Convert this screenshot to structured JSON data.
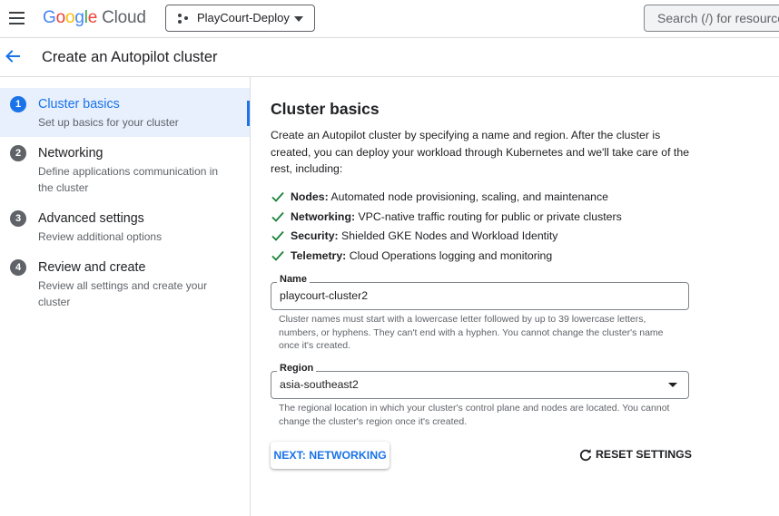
{
  "topbar": {
    "logo_letters": [
      "G",
      "o",
      "o",
      "g",
      "l",
      "e"
    ],
    "logo_product": "Cloud",
    "project_name": "PlayCourt-Deploy",
    "search_placeholder": "Search (/) for resources"
  },
  "page": {
    "title": "Create an Autopilot cluster"
  },
  "steps": [
    {
      "number": "1",
      "title": "Cluster basics",
      "description": "Set up basics for your cluster",
      "active": true
    },
    {
      "number": "2",
      "title": "Networking",
      "description": "Define applications communication in the cluster",
      "active": false
    },
    {
      "number": "3",
      "title": "Advanced settings",
      "description": "Review additional options",
      "active": false
    },
    {
      "number": "4",
      "title": "Review and create",
      "description": "Review all settings and create your cluster",
      "active": false
    }
  ],
  "main": {
    "section_title": "Cluster basics",
    "intro": "Create an Autopilot cluster by specifying a name and region. After the cluster is created, you can deploy your workload through Kubernetes and we'll take care of the rest, including:",
    "features": [
      {
        "label": "Nodes:",
        "text": " Automated node provisioning, scaling, and maintenance"
      },
      {
        "label": "Networking:",
        "text": " VPC-native traffic routing for public or private clusters"
      },
      {
        "label": "Security:",
        "text": " Shielded GKE Nodes and Workload Identity"
      },
      {
        "label": "Telemetry:",
        "text": " Cloud Operations logging and monitoring"
      }
    ],
    "name_field": {
      "label": "Name",
      "value": "playcourt-cluster2",
      "hint": "Cluster names must start with a lowercase letter followed by up to 39 lowercase letters, numbers, or hyphens. They can't end with a hyphen. You cannot change the cluster's name once it's created."
    },
    "region_field": {
      "label": "Region",
      "value": "asia-southeast2",
      "hint": "The regional location in which your cluster's control plane and nodes are located. You cannot change the cluster's region once it's created."
    },
    "next_button": "NEXT: NETWORKING",
    "reset_button": "RESET SETTINGS"
  },
  "colors": {
    "accent": "#1a73e8",
    "check": "#188038",
    "text": "#202124",
    "secondary_text": "#5f6368",
    "active_step_bg": "#e8f0fe"
  }
}
